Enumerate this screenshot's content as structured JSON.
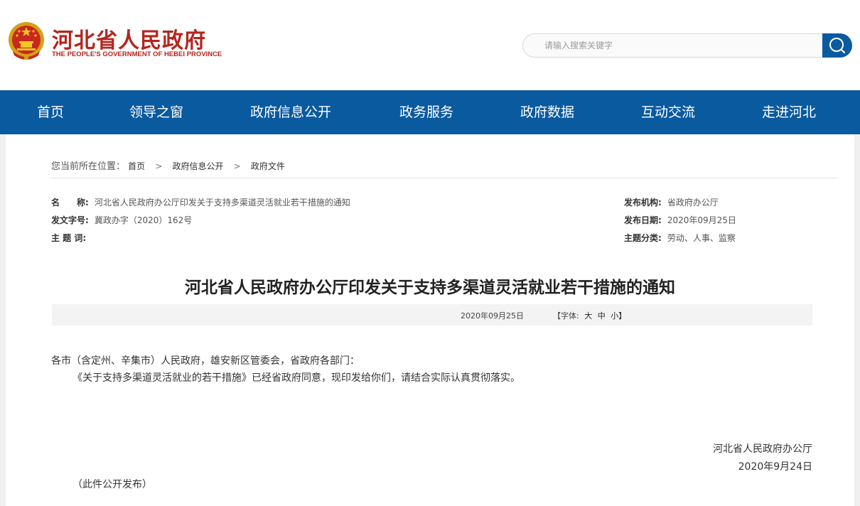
{
  "header": {
    "title": "河北省人民政府",
    "subtitle": "THE PEOPLE'S GOVERNMENT OF HEBEI PROVINCE",
    "search_placeholder": "请输入搜索关键字",
    "brand_color": "#b3261e"
  },
  "nav": {
    "color": "#0a5aa0",
    "items": [
      {
        "label": "首页"
      },
      {
        "label": "领导之窗"
      },
      {
        "label": "政府信息公开"
      },
      {
        "label": "政务服务"
      },
      {
        "label": "政府数据"
      },
      {
        "label": "互动交流"
      },
      {
        "label": "走进河北"
      }
    ]
  },
  "breadcrumb": {
    "prefix": "您当前所在位置：",
    "items": [
      "首页",
      "政府信息公开",
      "政府文件"
    ],
    "sep": ">"
  },
  "meta": {
    "name_label": "名　　称:",
    "name_value": "河北省人民政府办公厅印发关于支持多渠道灵活就业若干措施的通知",
    "docno_label": "发文字号:",
    "docno_value": "冀政办字（2020）162号",
    "keywords_label": "主 题 词:",
    "keywords_value": "",
    "org_label": "发布机构:",
    "org_value": "省政府办公厅",
    "date_label": "发布日期:",
    "date_value": "2020年09月25日",
    "category_label": "主题分类:",
    "category_value": "劳动、人事、监察"
  },
  "article": {
    "title": "河北省人民政府办公厅印发关于支持多渠道灵活就业若干措施的通知",
    "date": "2020年09月25日",
    "font_label": "【字体:",
    "font_large": "大",
    "font_medium": "中",
    "font_small": "小】",
    "salutation": "各市（含定州、辛集市）人民政府，雄安新区管委会，省政府各部门：",
    "paragraph": "《关于支持多渠道灵活就业的若干措施》已经省政府同意，现印发给你们，请结合实际认真贯彻落实。",
    "signature": "河北省人民政府办公厅",
    "sign_date": "2020年9月24日",
    "note": "（此件公开发布）"
  }
}
